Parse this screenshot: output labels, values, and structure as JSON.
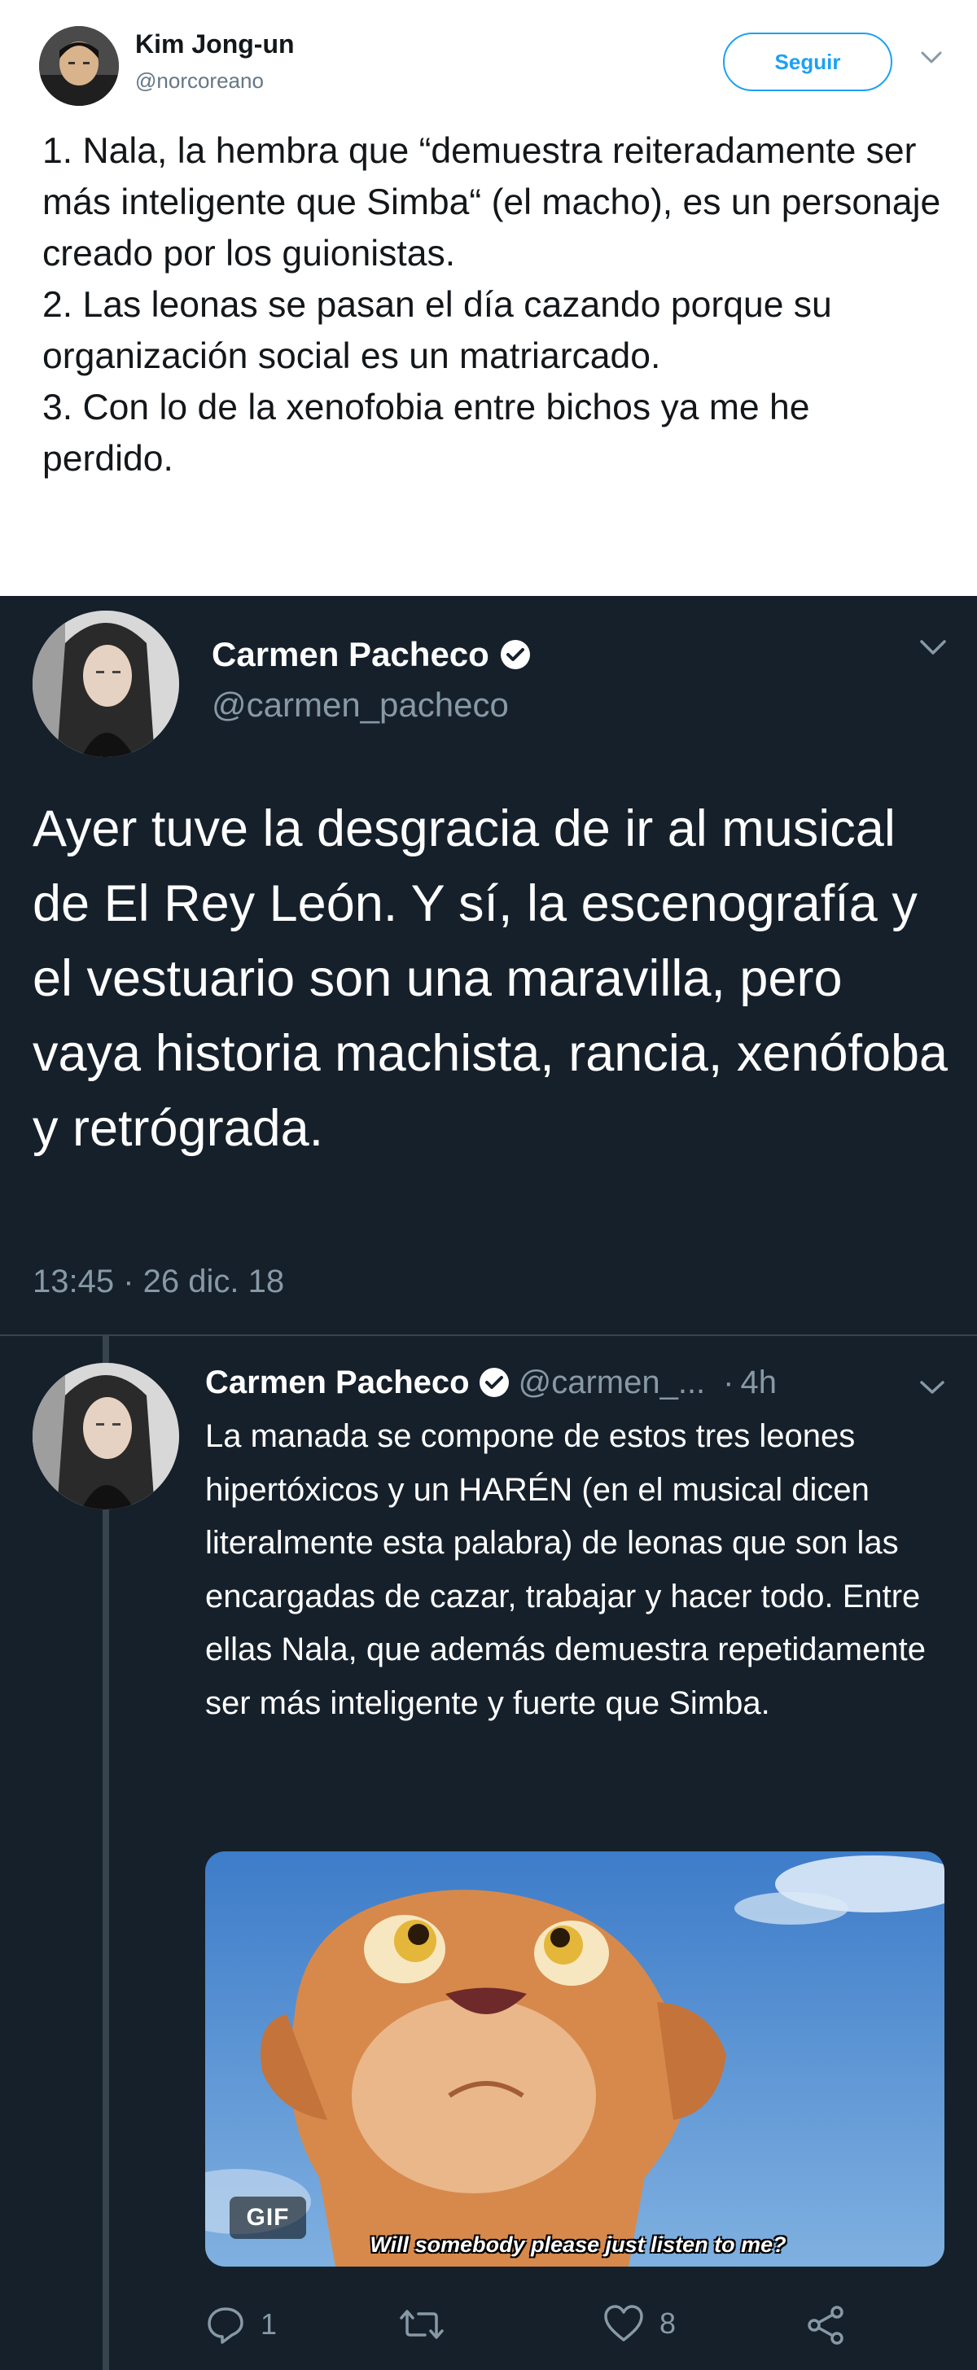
{
  "tweet1": {
    "author_name": "Kim Jong-un",
    "handle": "@norcoreano",
    "follow_label": "Seguir",
    "lines": [
      "1. Nala, la hembra que “demuestra reiteradamente ser más inteligente que Simba“ (el macho), es un personaje creado por los guionistas.",
      "2. Las leonas se pasan el día cazando porque su organización social es un matriarcado.",
      "3. Con lo de la xenofobia entre bichos ya me he perdido."
    ]
  },
  "tweet2": {
    "author_name": "Carmen Pacheco",
    "handle": "@carmen_pacheco",
    "text": "Ayer tuve la desgracia de ir al musical de El Rey León. Y sí, la escenografía y el vestuario son una maravilla, pero vaya historia machista, rancia, xenófoba y retrógrada.",
    "timestamp": "13:45 · 26 dic. 18"
  },
  "tweet3": {
    "author_name": "Carmen Pacheco",
    "handle": "@carmen_...",
    "separator": "·",
    "age": "4h",
    "text": "La manada se compone de estos tres leones hipertóxicos y un HARÉN (en el musical dicen literalmente esta palabra) de leonas que son las encargadas de cazar, trabajar y hacer todo. Entre ellas Nala, que además demuestra repetidamente ser más inteligente y fuerte que Simba.",
    "gif_badge": "GIF",
    "gif_caption": "Will somebody please just listen to me?",
    "reply_count": "1",
    "like_count": "8"
  },
  "colors": {
    "dark_bg": "#15202b",
    "muted": "#8899a6",
    "accent": "#1da1f2",
    "divider": "#38444d"
  },
  "icons": {
    "reply": "reply-icon",
    "retweet": "retweet-icon",
    "like": "like-icon",
    "share": "share-icon",
    "verified": "verified-badge-icon",
    "chevron": "chevron-down-icon"
  }
}
